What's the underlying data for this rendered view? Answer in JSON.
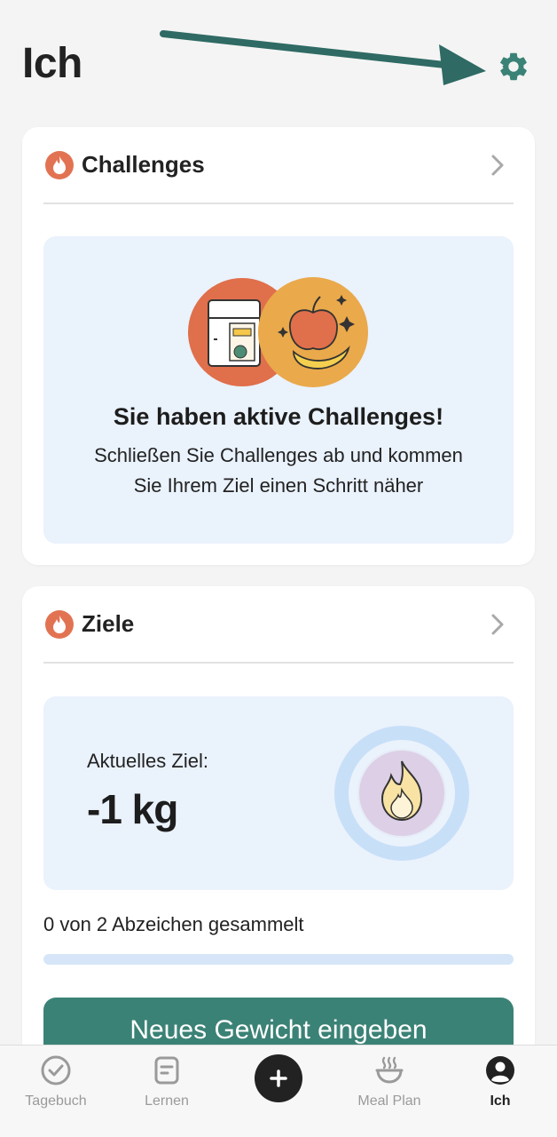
{
  "header": {
    "title": "Ich",
    "settings_icon": "gear-icon"
  },
  "challenges": {
    "title": "Challenges",
    "banner_title": "Sie haben aktive Challenges!",
    "banner_text_line1": "Schließen Sie Challenges ab und kommen",
    "banner_text_line2": "Sie Ihrem Ziel einen Schritt näher"
  },
  "goals": {
    "title": "Ziele",
    "current_label": "Aktuelles Ziel:",
    "current_value": "-1 kg",
    "badges_text": "0 von 2 Abzeichen gesammelt",
    "badges_collected": 0,
    "badges_total": 2,
    "button_label": "Neues Gewicht eingeben"
  },
  "tabbar": {
    "items": [
      {
        "label": "Tagebuch",
        "icon": "check-circle-icon"
      },
      {
        "label": "Lernen",
        "icon": "document-icon"
      },
      {
        "label": "",
        "icon": "plus-icon"
      },
      {
        "label": "Meal Plan",
        "icon": "bowl-icon"
      },
      {
        "label": "Ich",
        "icon": "profile-icon"
      }
    ],
    "active": "Ich"
  },
  "colors": {
    "accent": "#3b8276",
    "flame": "#e27352",
    "banner_bg": "#eaf2fc"
  }
}
